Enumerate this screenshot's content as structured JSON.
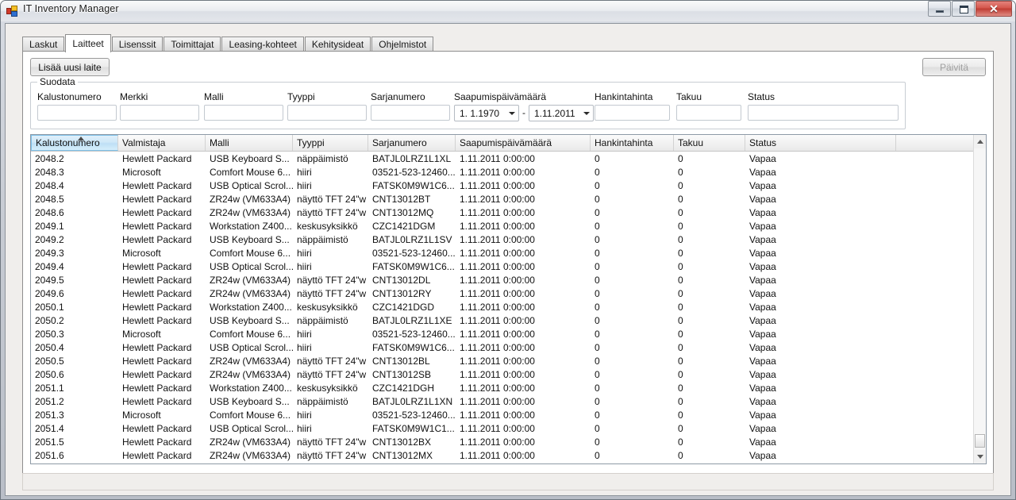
{
  "window": {
    "title": "IT Inventory Manager",
    "icon": "winforms-app-icon",
    "buttons": {
      "minimize": "minimize-button",
      "maximize": "maximize-button",
      "close": "✕"
    }
  },
  "tabs": [
    {
      "label": "Laskut",
      "selected": false
    },
    {
      "label": "Laitteet",
      "selected": true
    },
    {
      "label": "Lisenssit",
      "selected": false
    },
    {
      "label": "Toimittajat",
      "selected": false
    },
    {
      "label": "Leasing-kohteet",
      "selected": false
    },
    {
      "label": "Kehitysideat",
      "selected": false
    },
    {
      "label": "Ohjelmistot",
      "selected": false
    }
  ],
  "toolbar": {
    "add_device_label": "Lisää uusi laite",
    "refresh_label": "Päivitä",
    "refresh_enabled": false
  },
  "filter": {
    "legend": "Suodata",
    "fields": [
      {
        "label": "Kalustonumero",
        "value": "",
        "placeholder": ""
      },
      {
        "label": "Merkki",
        "value": "",
        "placeholder": ""
      },
      {
        "label": "Malli",
        "value": "",
        "placeholder": ""
      },
      {
        "label": "Tyyppi",
        "value": "",
        "placeholder": ""
      },
      {
        "label": "Sarjanumero",
        "value": "",
        "placeholder": ""
      }
    ],
    "date_range": {
      "label": "Saapumispäivämäärä",
      "from": "1.  1.1970",
      "separator": "-",
      "to": "1.11.2011"
    },
    "price": {
      "label": "Hankintahinta",
      "value": ""
    },
    "warranty": {
      "label": "Takuu",
      "value": ""
    },
    "status": {
      "label": "Status",
      "value": ""
    }
  },
  "grid": {
    "sorted_column": "Kalustonumero",
    "sort_direction": "ascending",
    "columns": [
      "Kalustonumero",
      "Valmistaja",
      "Malli",
      "Tyyppi",
      "Sarjanumero",
      "Saapumispäivämäärä",
      "Hankintahinta",
      "Takuu",
      "Status",
      ""
    ],
    "rows": [
      [
        "2048.2",
        "Hewlett Packard",
        "USB Keyboard S...",
        "näppäimistö",
        "BATJL0LRZ1L1XL",
        "1.11.2011 0:00:00",
        "0",
        "0",
        "Vapaa",
        ""
      ],
      [
        "2048.3",
        "Microsoft",
        "Comfort Mouse 6...",
        "hiiri",
        "03521-523-12460...",
        "1.11.2011 0:00:00",
        "0",
        "0",
        "Vapaa",
        ""
      ],
      [
        "2048.4",
        "Hewlett Packard",
        "USB Optical Scrol...",
        "hiiri",
        "FATSK0M9W1C6...",
        "1.11.2011 0:00:00",
        "0",
        "0",
        "Vapaa",
        ""
      ],
      [
        "2048.5",
        "Hewlett Packard",
        "ZR24w (VM633A4)",
        "näyttö TFT 24\"w",
        "CNT13012BT",
        "1.11.2011 0:00:00",
        "0",
        "0",
        "Vapaa",
        ""
      ],
      [
        "2048.6",
        "Hewlett Packard",
        "ZR24w (VM633A4)",
        "näyttö TFT 24\"w",
        "CNT13012MQ",
        "1.11.2011 0:00:00",
        "0",
        "0",
        "Vapaa",
        ""
      ],
      [
        "2049.1",
        "Hewlett Packard",
        "Workstation Z400...",
        "keskusyksikkö",
        "CZC1421DGM",
        "1.11.2011 0:00:00",
        "0",
        "0",
        "Vapaa",
        ""
      ],
      [
        "2049.2",
        "Hewlett Packard",
        "USB Keyboard S...",
        "näppäimistö",
        "BATJL0LRZ1L1SV",
        "1.11.2011 0:00:00",
        "0",
        "0",
        "Vapaa",
        ""
      ],
      [
        "2049.3",
        "Microsoft",
        "Comfort Mouse 6...",
        "hiiri",
        "03521-523-12460...",
        "1.11.2011 0:00:00",
        "0",
        "0",
        "Vapaa",
        ""
      ],
      [
        "2049.4",
        "Hewlett Packard",
        "USB Optical Scrol...",
        "hiiri",
        "FATSK0M9W1C6...",
        "1.11.2011 0:00:00",
        "0",
        "0",
        "Vapaa",
        ""
      ],
      [
        "2049.5",
        "Hewlett Packard",
        "ZR24w (VM633A4)",
        "näyttö TFT 24\"w",
        "CNT13012DL",
        "1.11.2011 0:00:00",
        "0",
        "0",
        "Vapaa",
        ""
      ],
      [
        "2049.6",
        "Hewlett Packard",
        "ZR24w (VM633A4)",
        "näyttö TFT 24\"w",
        "CNT13012RY",
        "1.11.2011 0:00:00",
        "0",
        "0",
        "Vapaa",
        ""
      ],
      [
        "2050.1",
        "Hewlett Packard",
        "Workstation Z400...",
        "keskusyksikkö",
        "CZC1421DGD",
        "1.11.2011 0:00:00",
        "0",
        "0",
        "Vapaa",
        ""
      ],
      [
        "2050.2",
        "Hewlett Packard",
        "USB Keyboard S...",
        "näppäimistö",
        "BATJL0LRZ1L1XE",
        "1.11.2011 0:00:00",
        "0",
        "0",
        "Vapaa",
        ""
      ],
      [
        "2050.3",
        "Microsoft",
        "Comfort Mouse 6...",
        "hiiri",
        "03521-523-12460...",
        "1.11.2011 0:00:00",
        "0",
        "0",
        "Vapaa",
        ""
      ],
      [
        "2050.4",
        "Hewlett Packard",
        "USB Optical Scrol...",
        "hiiri",
        "FATSK0M9W1C6...",
        "1.11.2011 0:00:00",
        "0",
        "0",
        "Vapaa",
        ""
      ],
      [
        "2050.5",
        "Hewlett Packard",
        "ZR24w (VM633A4)",
        "näyttö TFT 24\"w",
        "CNT13012BL",
        "1.11.2011 0:00:00",
        "0",
        "0",
        "Vapaa",
        ""
      ],
      [
        "2050.6",
        "Hewlett Packard",
        "ZR24w (VM633A4)",
        "näyttö TFT 24\"w",
        "CNT13012SB",
        "1.11.2011 0:00:00",
        "0",
        "0",
        "Vapaa",
        ""
      ],
      [
        "2051.1",
        "Hewlett Packard",
        "Workstation Z400...",
        "keskusyksikkö",
        "CZC1421DGH",
        "1.11.2011 0:00:00",
        "0",
        "0",
        "Vapaa",
        ""
      ],
      [
        "2051.2",
        "Hewlett Packard",
        "USB Keyboard S...",
        "näppäimistö",
        "BATJL0LRZ1L1XN",
        "1.11.2011 0:00:00",
        "0",
        "0",
        "Vapaa",
        ""
      ],
      [
        "2051.3",
        "Microsoft",
        "Comfort Mouse 6...",
        "hiiri",
        "03521-523-12460...",
        "1.11.2011 0:00:00",
        "0",
        "0",
        "Vapaa",
        ""
      ],
      [
        "2051.4",
        "Hewlett Packard",
        "USB Optical Scrol...",
        "hiiri",
        "FATSK0M9W1C1...",
        "1.11.2011 0:00:00",
        "0",
        "0",
        "Vapaa",
        ""
      ],
      [
        "2051.5",
        "Hewlett Packard",
        "ZR24w (VM633A4)",
        "näyttö TFT 24\"w",
        "CNT13012BX",
        "1.11.2011 0:00:00",
        "0",
        "0",
        "Vapaa",
        ""
      ],
      [
        "2051.6",
        "Hewlett Packard",
        "ZR24w (VM633A4)",
        "näyttö TFT 24\"w",
        "CNT13012MX",
        "1.11.2011 0:00:00",
        "0",
        "0",
        "Vapaa",
        ""
      ]
    ],
    "scrollbar": {
      "up_arrow": "scroll-up",
      "down_arrow": "scroll-down"
    }
  },
  "statusbar": {
    "text": ""
  },
  "colors": {
    "accent": "#cfe8f8",
    "grid_border": "#8e9aa6",
    "close_button": "#bf3b32",
    "window_chrome": "#c8ccd4"
  }
}
